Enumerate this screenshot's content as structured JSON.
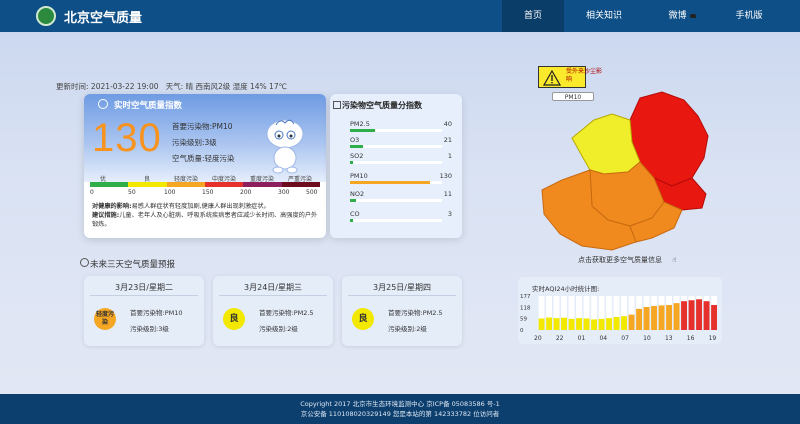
{
  "header": {
    "site_title": "北京空气质量",
    "nav": [
      "首页",
      "相关知识",
      "微博",
      "手机版"
    ]
  },
  "update": {
    "label": "更新时间:",
    "time": "2021-03-22 19:00",
    "weather": "天气: 晴 西南风2级 湿度 14% 17℃"
  },
  "realtime": {
    "title": "实时空气质量指数",
    "aqi": "130",
    "primary": "首要污染物:PM10",
    "level": "污染级别:3级",
    "quality": "空气质量:轻度污染",
    "levels": [
      "优",
      "良",
      "轻度污染",
      "中度污染",
      "重度污染",
      "严重污染"
    ],
    "scale_values": [
      "0",
      "50",
      "100",
      "150",
      "200",
      "300",
      "500"
    ],
    "level_colors": [
      "#2fae4a",
      "#f2e800",
      "#f5a623",
      "#e5302b",
      "#8e1f5e",
      "#6d0b1f"
    ],
    "impact_label": "对健康的影响:",
    "impact": "易感人群症状有轻度加剧,健康人群出现刺激症状。",
    "advice_label": "建议措施:",
    "advice": "儿童、老年人及心脏病、呼吸系统疾病患者应减少长时间、高强度的户外锻炼。"
  },
  "pollutants": {
    "title": "污染物空气质量分指数",
    "items": [
      {
        "name": "PM2.5",
        "value": "40",
        "color": "#2fae4a",
        "level": 0.27
      },
      {
        "name": "O3",
        "value": "21",
        "color": "#2fae4a",
        "level": 0.14
      },
      {
        "name": "SO2",
        "value": "1",
        "color": "#2fae4a",
        "level": 0.01
      },
      {
        "name": "PM10",
        "value": "130",
        "color": "#f5a623",
        "level": 0.87
      },
      {
        "name": "NO2",
        "value": "11",
        "color": "#2fae4a",
        "level": 0.07
      },
      {
        "name": "CO",
        "value": "3",
        "color": "#2fae4a",
        "level": 0.02
      }
    ]
  },
  "forecast": {
    "title": "未来三天空气质量预报",
    "days": [
      {
        "date": "3月23日/星期二",
        "badge": "轻度污染",
        "color": "#f5a623",
        "primary": "首要污染物:PM10",
        "level": "污染级别:3级"
      },
      {
        "date": "3月24日/星期三",
        "badge": "良",
        "color": "#f2e800",
        "primary": "首要污染物:PM2.5",
        "level": "污染级别:2级"
      },
      {
        "date": "3月25日/星期四",
        "badge": "良",
        "color": "#f2e800",
        "primary": "首要污染物:PM2.5",
        "level": "污染级别:2级"
      }
    ]
  },
  "map": {
    "warning": "受外来沙尘影响",
    "pollutant_tag": "PM10",
    "link": "点击获取更多空气质量信息"
  },
  "chart_data": {
    "type": "bar",
    "title": "实时AQI24小时统计图:",
    "y_ticks": [
      "177",
      "118",
      "59",
      "0"
    ],
    "ylim": [
      0,
      177
    ],
    "categories": [
      "20",
      "22",
      "01",
      "04",
      "07",
      "10",
      "13",
      "16",
      "19"
    ],
    "values": [
      60,
      65,
      62,
      64,
      58,
      62,
      60,
      55,
      58,
      62,
      68,
      72,
      80,
      110,
      120,
      125,
      128,
      130,
      140,
      150,
      155,
      160,
      150,
      130
    ],
    "colors": [
      "#f2e800",
      "#f2e800",
      "#f2e800",
      "#f2e800",
      "#f2e800",
      "#f2e800",
      "#f2e800",
      "#f2e800",
      "#f2e800",
      "#f2e800",
      "#f2e800",
      "#f2e800",
      "#f5a623",
      "#f5a623",
      "#f5a623",
      "#f5a623",
      "#f5a623",
      "#f5a623",
      "#f5a623",
      "#e5302b",
      "#e5302b",
      "#e5302b",
      "#e5302b",
      "#e5302b"
    ]
  },
  "footer": {
    "line1": "Copyright 2017 北京市生态环境监测中心   京ICP备 05083586 号-1",
    "line2": "京公安备 110108020329149      您是本站的第 142333782 位访问者"
  }
}
